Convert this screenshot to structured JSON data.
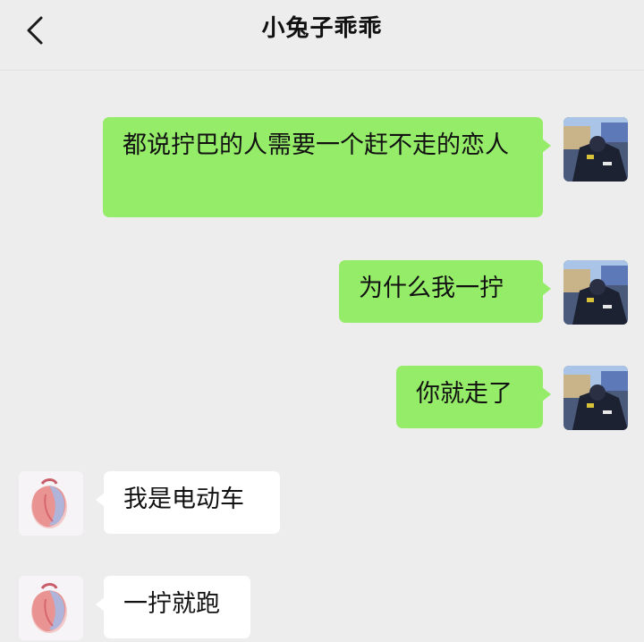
{
  "header": {
    "back_icon": "chevron-left-icon",
    "title": "小兔子乖乖"
  },
  "messages": [
    {
      "side": "right",
      "text": "都说拧巴的人需要一个赶不走的恋人"
    },
    {
      "side": "right",
      "text": "为什么我一拧"
    },
    {
      "side": "right",
      "text": "你就走了"
    },
    {
      "side": "left",
      "text": "我是电动车"
    },
    {
      "side": "left",
      "text": "一拧就跑"
    }
  ],
  "colors": {
    "background": "#ededed",
    "sent_bubble": "#95ec69",
    "received_bubble": "#ffffff"
  }
}
